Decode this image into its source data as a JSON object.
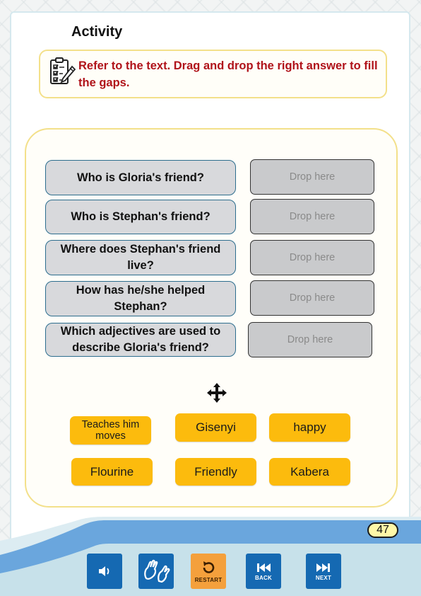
{
  "activity": {
    "title": "Activity",
    "instruction": "Refer to the text. Drag and drop the right answer to fill the gaps."
  },
  "questions": [
    {
      "text": "Who is Gloria's friend?",
      "drop_placeholder": "Drop here"
    },
    {
      "text": "Who is Stephan's friend?",
      "drop_placeholder": "Drop here"
    },
    {
      "text": "Where does Stephan's friend live?",
      "drop_placeholder": "Drop here"
    },
    {
      "text": "How has he/she helped Stephan?",
      "drop_placeholder": "Drop here"
    },
    {
      "text": "Which adjectives are used to describe Gloria's friend?",
      "drop_placeholder": "Drop here"
    }
  ],
  "answers": [
    "Teaches him moves",
    "Gisenyi",
    "happy",
    "Flourine",
    "Friendly",
    "Kabera"
  ],
  "page_number": "47",
  "controls": {
    "audio_label": "",
    "sign_label": "",
    "restart_label": "RESTART",
    "back_label": "BACK",
    "next_label": "NEXT"
  },
  "icons": {
    "instruction": "checklist-clipboard-icon",
    "drag": "move-arrows-icon",
    "audio": "speaker-icon",
    "sign": "sign-language-icon",
    "restart": "restart-icon",
    "back": "skip-back-icon",
    "next": "skip-forward-icon"
  },
  "colors": {
    "instruction_text": "#b0131a",
    "answer_chip": "#fcbb0d",
    "control_button": "#1569b2",
    "restart_button": "#f4a03c",
    "question_border": "#2d6e8e",
    "panel_border": "#f3e08a"
  }
}
